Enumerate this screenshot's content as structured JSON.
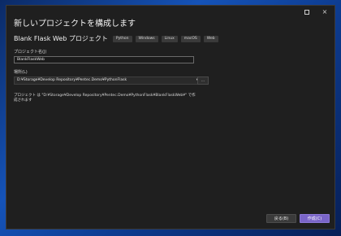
{
  "dialog": {
    "title": "新しいプロジェクトを構成します",
    "window_controls": {
      "maximize_icon": "maximize-icon",
      "close_glyph": "×"
    }
  },
  "template": {
    "name": "Blank Flask Web プロジェクト",
    "tags": [
      "Python",
      "Windows",
      "Linux",
      "macOS",
      "Web"
    ]
  },
  "project_name": {
    "label": "プロジェクト名(J)",
    "value": "BlankFlaskWeb"
  },
  "location": {
    "label": "場所(L)",
    "value": "D:¥Storage¥Develop Repository¥Pentec.Demo¥PythonFlask",
    "browse_label": "..."
  },
  "info_text": "プロジェクト は \"D:¥Storage¥Develop Repository¥Pentec.Demo¥PythonFlask¥BlankFlaskWeb¥\" で作成されます",
  "buttons": {
    "back": "戻る(B)",
    "create": "作成(C)"
  },
  "colors": {
    "accent": "#7a65c8",
    "dialog_bg": "#1f1f1f"
  }
}
